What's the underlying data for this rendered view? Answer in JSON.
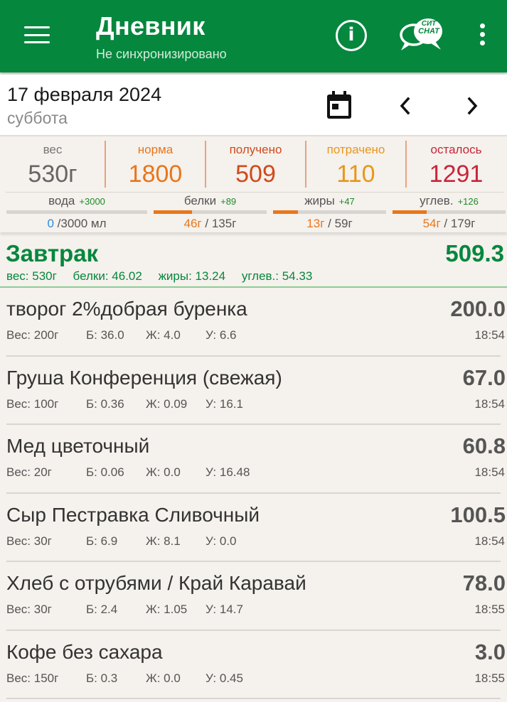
{
  "appbar": {
    "title": "Дневник",
    "subtitle": "Не синхронизировано",
    "chat_line1": "СИТ",
    "chat_line2": "CHAT",
    "icons": [
      "menu-icon",
      "info-icon",
      "chat-icon",
      "more-vert-icon"
    ]
  },
  "date": {
    "main": "17 февраля 2024",
    "weekday": "суббота",
    "icons": [
      "calendar-icon",
      "chevron-left-icon",
      "chevron-right-icon"
    ]
  },
  "summary": {
    "weight": {
      "label": "вес",
      "value": "530г",
      "color": "#666666"
    },
    "norm": {
      "label": "норма",
      "value": "1800",
      "color": "#e8761c"
    },
    "received": {
      "label": "получено",
      "value": "509",
      "color": "#d04a1c"
    },
    "spent": {
      "label": "потрачено",
      "value": "110",
      "color": "#e8961c"
    },
    "remaining": {
      "label": "осталось",
      "value": "1291",
      "color": "#c8253a"
    },
    "macros": [
      {
        "label": "вода",
        "plus": "+3000",
        "current": "0",
        "total": " /3000 мл",
        "fraction": 0.0
      },
      {
        "label": "белки",
        "plus": "+89",
        "current": "46г",
        "total": " / 135г",
        "fraction": 0.34
      },
      {
        "label": "жиры",
        "plus": "+47",
        "current": "13г",
        "total": " / 59г",
        "fraction": 0.22
      },
      {
        "label": "углев.",
        "plus": "+126",
        "current": "54г",
        "total": " / 179г",
        "fraction": 0.3
      }
    ]
  },
  "meal": {
    "name": "Завтрак",
    "total": "509.3",
    "weight": "вес: 530г",
    "protein": "белки: 46.02",
    "fat": "жиры: 13.24",
    "carbs": "углев.: 54.33"
  },
  "foods": [
    {
      "name": "творог 2%добрая буренка",
      "kcal": "200.0",
      "weight": "Вес: 200г",
      "p": "Б: 36.0",
      "f": "Ж: 4.0",
      "c": "У: 6.6",
      "time": "18:54"
    },
    {
      "name": "Груша Конференция (свежая)",
      "kcal": "67.0",
      "weight": "Вес: 100г",
      "p": "Б: 0.36",
      "f": "Ж: 0.09",
      "c": "У: 16.1",
      "time": "18:54"
    },
    {
      "name": "Мед цветочный",
      "kcal": "60.8",
      "weight": "Вес: 20г",
      "p": "Б: 0.06",
      "f": "Ж: 0.0",
      "c": "У: 16.48",
      "time": "18:54"
    },
    {
      "name": "Сыр Пестравка Сливочный",
      "kcal": "100.5",
      "weight": "Вес: 30г",
      "p": "Б: 6.9",
      "f": "Ж: 8.1",
      "c": "У: 0.0",
      "time": "18:54"
    },
    {
      "name": "Хлеб с отрубями / Край Каравай",
      "kcal": "78.0",
      "weight": "Вес: 30г",
      "p": "Б: 2.4",
      "f": "Ж: 1.05",
      "c": "У: 14.7",
      "time": "18:55"
    },
    {
      "name": "Кофе без сахара",
      "kcal": "3.0",
      "weight": "Вес: 150г",
      "p": "Б: 0.3",
      "f": "Ж: 0.0",
      "c": "У: 0.45",
      "time": "18:55"
    }
  ],
  "colors": {
    "brand_green": "#05873e",
    "accent_orange": "#e8761c",
    "water_blue": "#2a8ce0"
  }
}
